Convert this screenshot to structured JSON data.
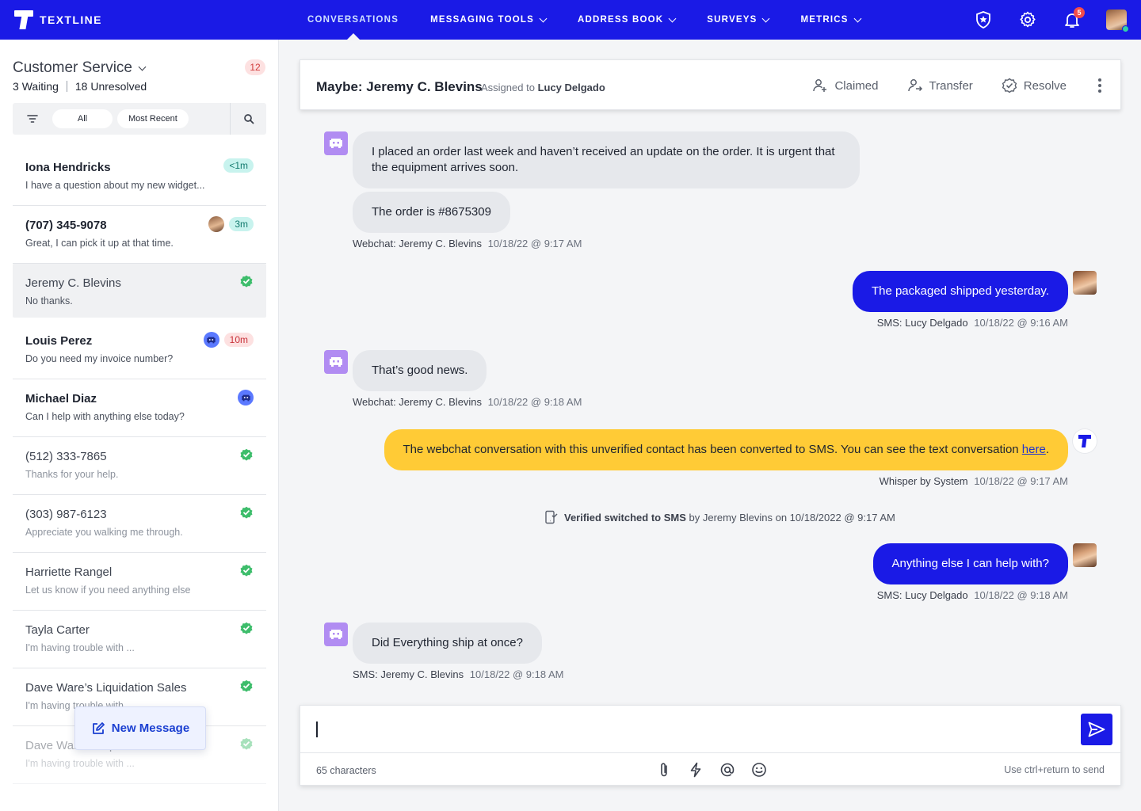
{
  "app": {
    "logo_text": "TEXTLINE"
  },
  "nav": {
    "items": [
      {
        "label": "CONVERSATIONS",
        "active": true,
        "dropdown": false
      },
      {
        "label": "MESSAGING TOOLS",
        "active": false,
        "dropdown": true
      },
      {
        "label": "ADDRESS BOOK",
        "active": false,
        "dropdown": true
      },
      {
        "label": "SURVEYS",
        "active": false,
        "dropdown": true
      },
      {
        "label": "METRICS",
        "active": false,
        "dropdown": true
      }
    ],
    "notification_count": "5",
    "icons": [
      "shield-icon",
      "gear-icon",
      "bell-icon",
      "user-avatar"
    ]
  },
  "sidebar": {
    "title": "Customer Service",
    "count": "12",
    "waiting": "3",
    "waiting_label": "Waiting",
    "unresolved": "18",
    "unresolved_label": "Unresolved",
    "filters": {
      "all": "All",
      "recent": "Most Recent"
    },
    "conversations": [
      {
        "name": "Iona Hendricks",
        "preview": "I have a question about my new widget...",
        "time": "<1m",
        "badge": "teal",
        "style": "bold",
        "extra": "none"
      },
      {
        "name": "(707) 345-9078",
        "preview": "Great, I can pick it up at that time.",
        "time": "3m",
        "badge": "teal",
        "style": "bold",
        "extra": "avatar"
      },
      {
        "name": "Jeremy C. Blevins",
        "preview": "No thanks.",
        "time": "",
        "badge": "check",
        "style": "dim",
        "extra": "none",
        "selected": true
      },
      {
        "name": "Louis Perez",
        "preview": "Do you need my invoice number?",
        "time": "10m",
        "badge": "red",
        "style": "bold",
        "extra": "robot"
      },
      {
        "name": "Michael Diaz",
        "preview": "Can I help with anything else today?",
        "time": "",
        "badge": "robot",
        "style": "bold",
        "extra": "none"
      },
      {
        "name": "(512) 333-7865",
        "preview": "Thanks for your help.",
        "time": "",
        "badge": "check",
        "style": "dim",
        "extra": "none"
      },
      {
        "name": "(303) 987-6123",
        "preview": "Appreciate you walking me through.",
        "time": "",
        "badge": "check",
        "style": "dim",
        "extra": "none"
      },
      {
        "name": "Harriette Rangel",
        "preview": "Let us know if you need anything else",
        "time": "",
        "badge": "check",
        "style": "dim",
        "extra": "none"
      },
      {
        "name": "Tayla Carter",
        "preview": "I'm having trouble with ...",
        "time": "",
        "badge": "check",
        "style": "dim",
        "extra": "none"
      },
      {
        "name": "Dave Ware’s Liquidation Sales",
        "preview": "I'm having trouble with ...",
        "time": "",
        "badge": "check",
        "style": "dim",
        "extra": "none"
      },
      {
        "name": "Dave Ware’s Liquidation Sales",
        "preview": "I'm having trouble with ...",
        "time": "",
        "badge": "check",
        "style": "dim",
        "extra": "none",
        "faded": true
      }
    ],
    "new_message_label": "New Message"
  },
  "conversation": {
    "title": "Maybe: Jeremy C. Blevins",
    "assigned_prefix": "Assigned to",
    "assigned_to": "Lucy Delgado",
    "actions": {
      "claimed": "Claimed",
      "transfer": "Transfer",
      "resolve": "Resolve"
    },
    "messages": {
      "m1": "I placed an order last week and haven’t received an update on the order. It is urgent that the equipment arrives soon.",
      "m2": "The order is #8675309",
      "m2_meta": {
        "channel": "Webchat: Jeremy C. Blevins",
        "ts": "10/18/22 @ 9:17 AM"
      },
      "m3": "The packaged shipped yesterday.",
      "m3_meta": {
        "channel": "SMS: Lucy Delgado",
        "ts": "10/18/22 @ 9:16 AM"
      },
      "m4": "That’s good news.",
      "m4_meta": {
        "channel": "Webchat: Jeremy C. Blevins",
        "ts": "10/18/22 @ 9:18 AM"
      },
      "m5": "The webchat conversation with this unverified contact has been converted to SMS. You can see the text conversation ",
      "m5_link": "here",
      "m5_end": ".",
      "m5_meta": {
        "channel": "Whisper by System",
        "ts": "10/18/22 @ 9:17 AM"
      },
      "event_bold": "Verified switched to SMS",
      "event_text": "by Jeremy Blevins on 10/18/2022 @ 9:17 AM",
      "m6": "Anything else I can help with?",
      "m6_meta": {
        "channel": "SMS: Lucy Delgado",
        "ts": "10/18/22 @ 9:18 AM"
      },
      "m7": "Did Everything ship at once?",
      "m7_meta": {
        "channel": "SMS: Jeremy C. Blevins",
        "ts": "10/18/22 @ 9:18 AM"
      }
    }
  },
  "composer": {
    "value": "",
    "char_count": "65 characters",
    "hint": "Use ctrl+return to send"
  },
  "colors": {
    "primary": "#1a1ae6",
    "whisper": "#ffcb36",
    "check": "#3dbd6b",
    "incoming_avatar": "#b18cf2"
  }
}
